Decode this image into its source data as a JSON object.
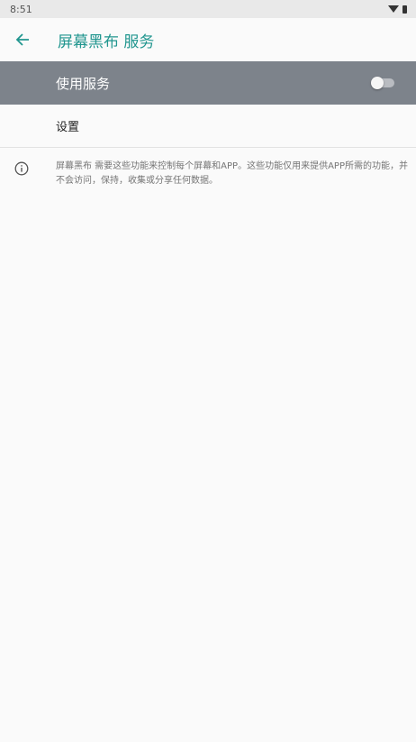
{
  "status_bar": {
    "time": "8:51",
    "icons": [
      "wifi-icon",
      "battery-icon"
    ]
  },
  "app_bar": {
    "back_icon": "arrow-back-icon",
    "title": "屏幕黑布 服务",
    "title_color": "#21968f"
  },
  "master_switch": {
    "label": "使用服务",
    "checked": false,
    "background_color": "#7d838b"
  },
  "settings": {
    "label": "设置"
  },
  "footer": {
    "icon": "info-icon",
    "text": "屏幕黑布 需要这些功能来控制每个屏幕和APP。这些功能仅用来提供APP所需的功能，并不会访问，保持，收集或分享任何数据。"
  }
}
